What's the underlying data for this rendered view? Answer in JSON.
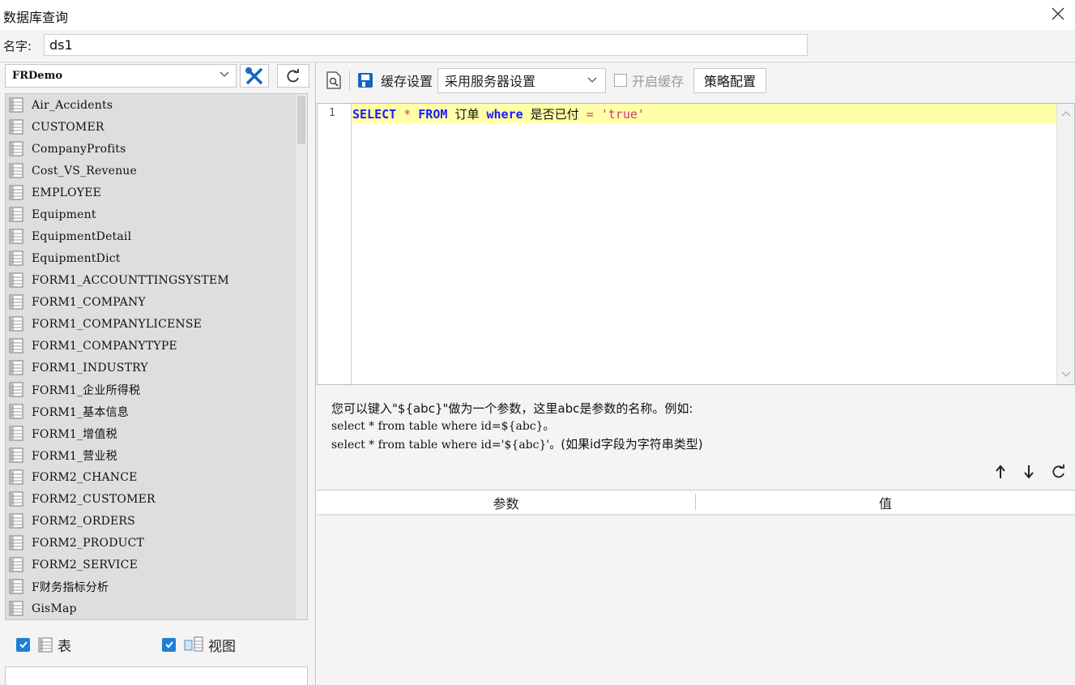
{
  "window": {
    "title": "数据库查询"
  },
  "name_field": {
    "label": "名字:",
    "value": "ds1"
  },
  "left_panel": {
    "datasource": "FRDemo",
    "tables": [
      "Air_Accidents",
      "CUSTOMER",
      "CompanyProfits",
      "Cost_VS_Revenue",
      "EMPLOYEE",
      "Equipment",
      "EquipmentDetail",
      "EquipmentDict",
      "FORM1_ACCOUNTTINGSYSTEM",
      "FORM1_COMPANY",
      "FORM1_COMPANYLICENSE",
      "FORM1_COMPANYTYPE",
      "FORM1_INDUSTRY",
      "FORM1_企业所得税",
      "FORM1_基本信息",
      "FORM1_增值税",
      "FORM1_营业税",
      "FORM2_CHANCE",
      "FORM2_CUSTOMER",
      "FORM2_ORDERS",
      "FORM2_PRODUCT",
      "FORM2_SERVICE",
      "F财务指标分析",
      "GisMap"
    ],
    "filter_table_label": "表",
    "filter_view_label": "视图"
  },
  "toolbar": {
    "cache_label": "缓存设置",
    "cache_value": "采用服务器设置",
    "enable_cache_label": "开启缓存",
    "policy_button": "策略配置"
  },
  "editor": {
    "line_number": "1",
    "tokens": {
      "select": "SELECT",
      "star": "*",
      "from": "FROM",
      "table": "订单",
      "where": "where",
      "column": "是否已付",
      "eq": "=",
      "value": "'true'"
    }
  },
  "hint": {
    "line1": "您可以键入\"${abc}\"做为一个参数，这里abc是参数的名称。例如:",
    "line2": "select * from table where id=${abc}。",
    "line3a": "select * from table where id='${abc}'。",
    "line3b": "(如果id字段为字符串类型)"
  },
  "params_table": {
    "col_param": "参数",
    "col_value": "值"
  }
}
